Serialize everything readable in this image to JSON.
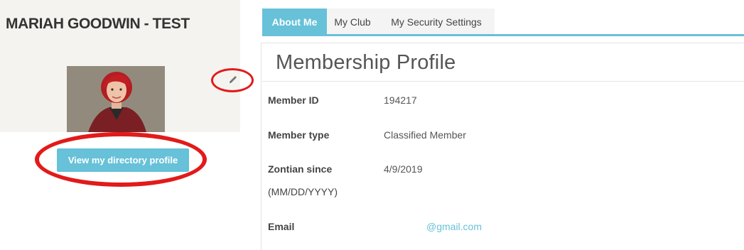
{
  "member": {
    "name": "MARIAH GOODWIN - TEST",
    "directory_button_label": "View my directory profile"
  },
  "tabs": [
    {
      "label": "About Me",
      "active": true
    },
    {
      "label": "My Club",
      "active": false
    },
    {
      "label": "My Security Settings",
      "active": false
    }
  ],
  "profile": {
    "title": "Membership Profile",
    "fields": [
      {
        "label": "Member ID",
        "value": "194217"
      },
      {
        "label": "Member type",
        "value": "Classified Member"
      },
      {
        "label": "Zontian since",
        "label2": "(MM/DD/YYYY)",
        "value": "4/9/2019"
      },
      {
        "label": "Email",
        "value": "@gmail.com"
      }
    ]
  },
  "icons": {
    "edit": "pencil-icon"
  },
  "colors": {
    "accent": "#67c1d8",
    "annotation": "#e21a1a",
    "panel_bg": "#f4f3ef"
  }
}
